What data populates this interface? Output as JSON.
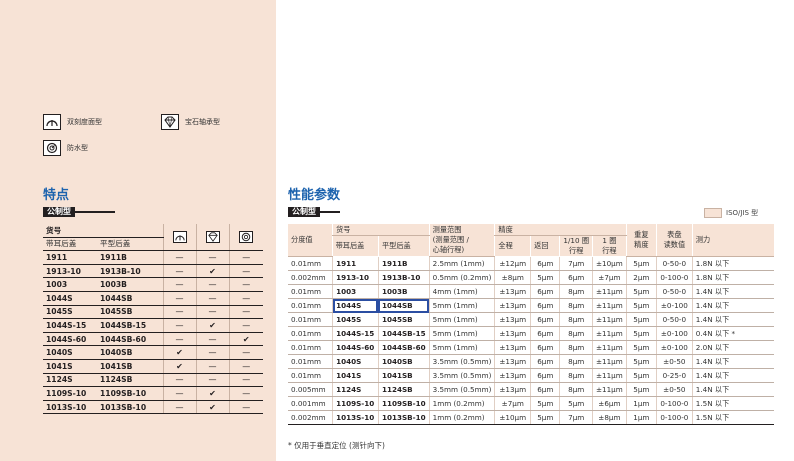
{
  "legend": [
    {
      "icon": "dual-scale-dial-icon",
      "label": "双刻度面型"
    },
    {
      "icon": "jewel-bearing-icon",
      "label": "宝石轴承型"
    },
    {
      "icon": "waterproof-icon",
      "label": "防水型"
    }
  ],
  "features": {
    "heading": "特点",
    "metric_label": "公制型",
    "col_part_no": "货号",
    "col_lug_back": "带耳后盖",
    "col_flat_back": "平型后盖",
    "rows": [
      {
        "lug": "1911",
        "flat": "1911B",
        "a": "—",
        "b": "—",
        "c": "—"
      },
      {
        "lug": "1913-10",
        "flat": "1913B-10",
        "a": "—",
        "b": "✔",
        "c": "—"
      },
      {
        "lug": "1003",
        "flat": "1003B",
        "a": "—",
        "b": "—",
        "c": "—"
      },
      {
        "lug": "1044S",
        "flat": "1044SB",
        "a": "—",
        "b": "—",
        "c": "—"
      },
      {
        "lug": "1045S",
        "flat": "1045SB",
        "a": "—",
        "b": "—",
        "c": "—"
      },
      {
        "lug": "1044S-15",
        "flat": "1044SB-15",
        "a": "—",
        "b": "✔",
        "c": "—"
      },
      {
        "lug": "1044S-60",
        "flat": "1044SB-60",
        "a": "—",
        "b": "—",
        "c": "✔"
      },
      {
        "lug": "1040S",
        "flat": "1040SB",
        "a": "✔",
        "b": "—",
        "c": "—"
      },
      {
        "lug": "1041S",
        "flat": "1041SB",
        "a": "✔",
        "b": "—",
        "c": "—"
      },
      {
        "lug": "1124S",
        "flat": "1124SB",
        "a": "—",
        "b": "—",
        "c": "—"
      },
      {
        "lug": "1109S-10",
        "flat": "1109SB-10",
        "a": "—",
        "b": "✔",
        "c": "—"
      },
      {
        "lug": "1013S-10",
        "flat": "1013SB-10",
        "a": "—",
        "b": "✔",
        "c": "—"
      }
    ]
  },
  "specs": {
    "heading": "性能参数",
    "metric_label": "公制型",
    "iso_key": "ISO/JIS 型",
    "headers": {
      "graduation": "分度值",
      "part_no": "货号",
      "lug_back": "带耳后盖",
      "flat_back": "平型后盖",
      "range_l1": "测量范围",
      "range_l2": "(测量范围 /",
      "range_l3": "心轴行程)",
      "accuracy": "精度",
      "full": "全程",
      "retrace": "返回",
      "tenth_l1": "1/10 圈",
      "tenth_l2": "行程",
      "one_l1": "1 圈",
      "one_l2": "行程",
      "repeat_l1": "重复",
      "repeat_l2": "精度",
      "dial_l1": "表盘",
      "dial_l2": "读数值",
      "force": "测力"
    },
    "rows": [
      [
        "0.01mm",
        "1911",
        "1911B",
        "2.5mm (1mm)",
        "±12μm",
        "6μm",
        "7μm",
        "±10μm",
        "5μm",
        "0-50-0",
        "1.8N 以下"
      ],
      [
        "0.002mm",
        "1913-10",
        "1913B-10",
        "0.5mm (0.2mm)",
        "±8μm",
        "5μm",
        "6μm",
        "±7μm",
        "2μm",
        "0-100-0",
        "1.8N 以下"
      ],
      [
        "0.01mm",
        "1003",
        "1003B",
        "4mm (1mm)",
        "±13μm",
        "6μm",
        "8μm",
        "±11μm",
        "5μm",
        "0-50-0",
        "1.4N 以下"
      ],
      [
        "0.01mm",
        "1044S",
        "1044SB",
        "5mm (1mm)",
        "±13μm",
        "6μm",
        "8μm",
        "±11μm",
        "5μm",
        "±0-100",
        "1.4N 以下"
      ],
      [
        "0.01mm",
        "1045S",
        "1045SB",
        "5mm (1mm)",
        "±13μm",
        "6μm",
        "8μm",
        "±11μm",
        "5μm",
        "0-50-0",
        "1.4N 以下"
      ],
      [
        "0.01mm",
        "1044S-15",
        "1044SB-15",
        "5mm (1mm)",
        "±13μm",
        "6μm",
        "8μm",
        "±11μm",
        "5μm",
        "±0-100",
        "0.4N 以下 *"
      ],
      [
        "0.01mm",
        "1044S-60",
        "1044SB-60",
        "5mm (1mm)",
        "±13μm",
        "6μm",
        "8μm",
        "±11μm",
        "5μm",
        "±0-100",
        "2.0N 以下"
      ],
      [
        "0.01mm",
        "1040S",
        "1040SB",
        "3.5mm (0.5mm)",
        "±13μm",
        "6μm",
        "8μm",
        "±11μm",
        "5μm",
        "±0-50",
        "1.4N 以下"
      ],
      [
        "0.01mm",
        "1041S",
        "1041SB",
        "3.5mm (0.5mm)",
        "±13μm",
        "6μm",
        "8μm",
        "±11μm",
        "5μm",
        "0-25-0",
        "1.4N 以下"
      ],
      [
        "0.005mm",
        "1124S",
        "1124SB",
        "3.5mm (0.5mm)",
        "±13μm",
        "6μm",
        "8μm",
        "±11μm",
        "5μm",
        "±0-50",
        "1.4N 以下"
      ],
      [
        "0.001mm",
        "1109S-10",
        "1109SB-10",
        "1mm (0.2mm)",
        "±7μm",
        "5μm",
        "5μm",
        "±6μm",
        "1μm",
        "0-100-0",
        "1.5N 以下"
      ],
      [
        "0.002mm",
        "1013S-10",
        "1013SB-10",
        "1mm (0.2mm)",
        "±10μm",
        "5μm",
        "7μm",
        "±8μm",
        "1μm",
        "0-100-0",
        "1.5N 以下"
      ]
    ],
    "highlight_row": 3,
    "footnote": "* 仅用于垂直定位 (测针向下)"
  },
  "colors": {
    "panel": "#f7e3d6",
    "heading": "#1d63ae",
    "highlight": "#2b4ea2"
  }
}
